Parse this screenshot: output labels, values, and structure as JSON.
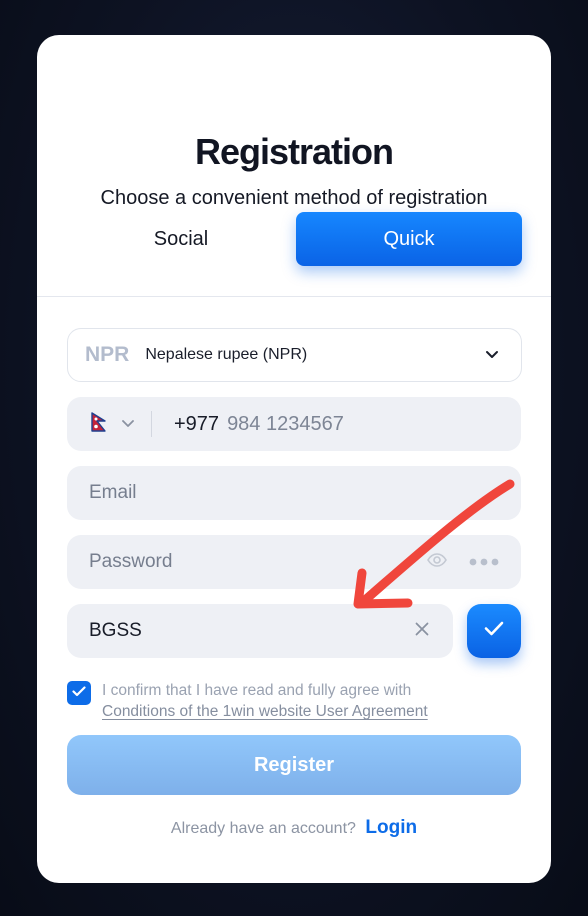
{
  "modal": {
    "title": "Registration",
    "subtitle": "Choose a convenient method of registration"
  },
  "tabs": {
    "social": "Social",
    "quick": "Quick",
    "active": "Quick"
  },
  "currency": {
    "code": "NPR",
    "name": "Nepalese rupee (NPR)"
  },
  "phone": {
    "country_flag": "nepal-flag-icon",
    "prefix": "+977",
    "placeholder": "984 1234567"
  },
  "email": {
    "placeholder": "Email"
  },
  "password": {
    "placeholder": "Password"
  },
  "promo": {
    "value": "BGSS"
  },
  "agreement": {
    "checked": true,
    "text": "I confirm that I have read and fully agree with",
    "link": "Conditions of the 1win website User Agreement"
  },
  "register": {
    "label": "Register"
  },
  "footer": {
    "question": "Already have an account?",
    "login": "Login"
  },
  "colors": {
    "accent": "#0d6ce8",
    "register_disabled": "#8bbcf2",
    "annotation_arrow": "#f0463c"
  }
}
